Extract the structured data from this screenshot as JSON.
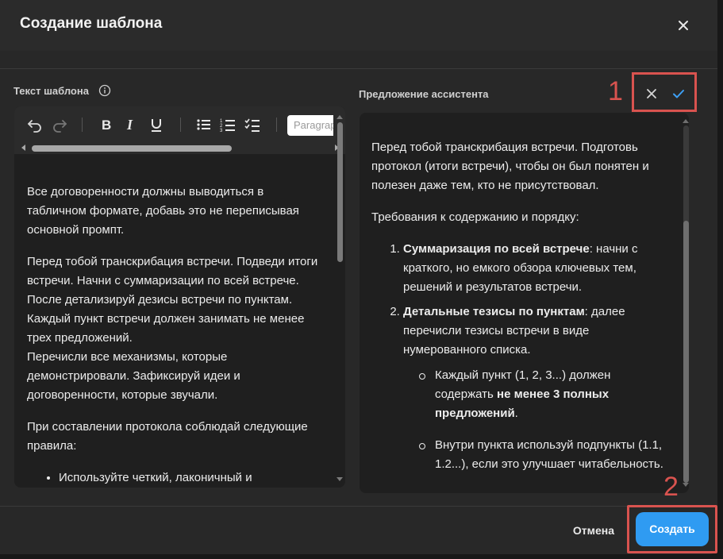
{
  "dialog": {
    "title": "Создание шаблона"
  },
  "left_panel": {
    "label": "Текст шаблона",
    "paragraph_select": "Paragraph",
    "paragraphs": [
      "Все договоренности должны выводиться в табличном формате, добавь это не переписывая основной промпт.",
      "Перед тобой транскрибация встречи. Подведи итоги встречи. Начни с суммаризации по всей встрече. После детализируй дезисы встречи по пунктам. Каждый пункт встречи должен занимать не менее трех предложений.",
      "Перечисли все механизмы, которые демонстрировали. Зафиксируй идеи и договоренности, которые звучали.",
      "При составлении протокола соблюдай следующие правила:"
    ],
    "bullet": "Используйте четкий, лаконичный и"
  },
  "right_panel": {
    "label": "Предложение ассистента",
    "intro": "Перед тобой транскрибация встречи. Подготовь протокол (итоги встречи), чтобы он был понятен и полезен даже тем, кто не присутствовал.",
    "requirements": "Требования к содержанию и порядку:",
    "item1_bold": "Суммаризация по всей встрече",
    "item1_text": ": начни с краткого, но емкого обзора ключевых тем, решений и результатов встречи.",
    "item2_bold": "Детальные тезисы по пунктам",
    "item2_text": ": далее перечисли тезисы встречи в виде нумерованного списка.",
    "sub1_text": "Каждый пункт (1, 2, 3...) должен содержать ",
    "sub1_bold": "не менее 3 полных предложений",
    "sub1_end": ".",
    "sub2_text": "Внутри пункта используй подпункты (1.1, 1.2...), если это улучшает читабельность."
  },
  "annotations": {
    "marker_1": "1",
    "marker_2": "2",
    "color": "#d9534f"
  },
  "footer": {
    "cancel_label": "Отмена",
    "create_label": "Создать",
    "accent": "#2f9bf2"
  },
  "icons": [
    "close-icon",
    "info-icon",
    "undo-icon",
    "redo-icon",
    "bold-icon",
    "italic-icon",
    "underline-icon",
    "bullet-list-icon",
    "numbered-list-icon",
    "checklist-icon",
    "reject-icon",
    "accept-icon"
  ]
}
